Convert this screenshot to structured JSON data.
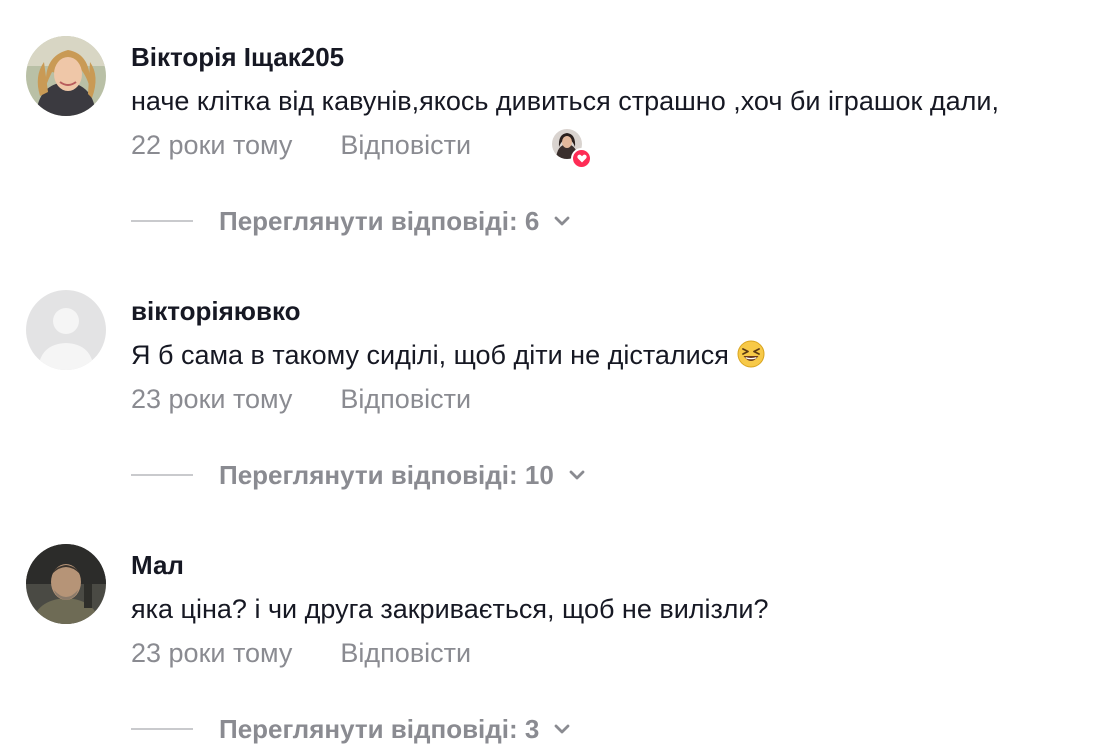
{
  "comments": [
    {
      "username": "Вікторія Іщак205",
      "text": "наче клітка від кавунів,якось дивиться страшно ,хоч би іграшок дали,",
      "time": "22 роки тому",
      "reply_label": "Відповісти",
      "view_replies": "Переглянути відповіді: 6",
      "liked_by_creator": true
    },
    {
      "username": "вікторіяювко",
      "text": "Я б сама в такому сиділі, щоб діти не дісталися",
      "emoji": "laughing-squint-emoji",
      "time": "23 роки тому",
      "reply_label": "Відповісти",
      "view_replies": "Переглянути відповіді: 10"
    },
    {
      "username": "Мал",
      "text": "яка ціна? і чи друга закривається, щоб не вилізли?",
      "time": "23 роки тому",
      "reply_label": "Відповісти",
      "view_replies": "Переглянути відповіді: 3"
    }
  ],
  "colors": {
    "primary_text": "#161823",
    "secondary_text": "#8a8b91",
    "like_red": "#fe2c55",
    "divider": "#c9cacd"
  }
}
